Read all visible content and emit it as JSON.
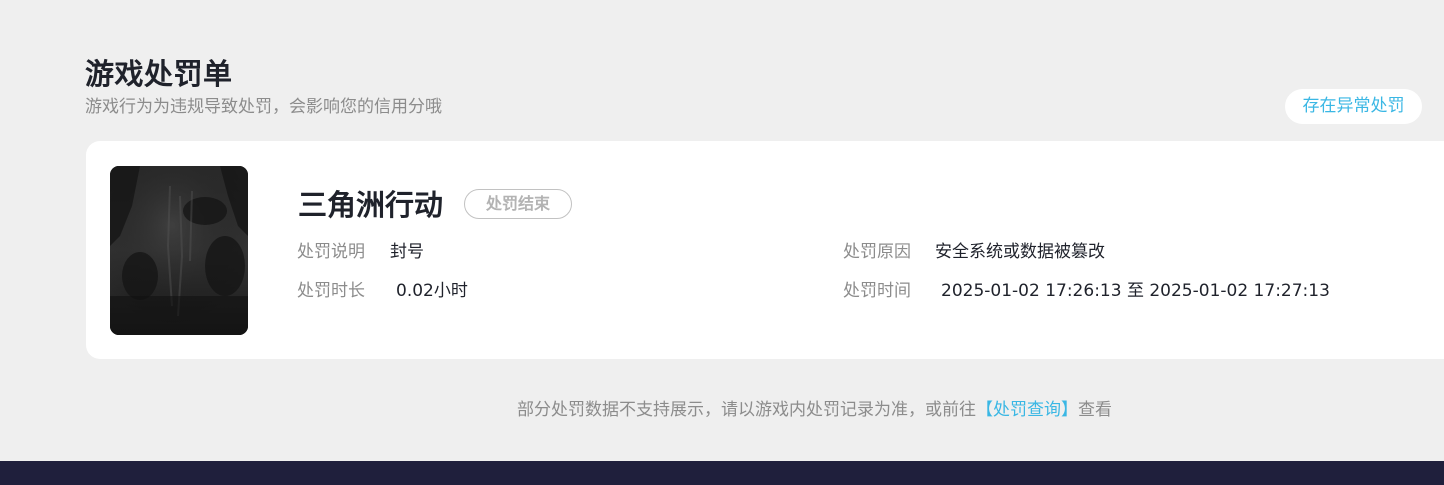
{
  "header": {
    "title": "游戏处罚单",
    "subtitle": "游戏行为为违规导致处罚，会影响您的信用分哦"
  },
  "anomaly_button": {
    "label": "存在异常处罚"
  },
  "penalty": {
    "cover_icon": "game-cover-image",
    "game_name": "三角洲行动",
    "status": "处罚结束",
    "description_label": "处罚说明",
    "description_value": "封号",
    "reason_label": "处罚原因",
    "reason_value": "安全系统或数据被篡改",
    "duration_label": "处罚时长",
    "duration_value": "0.02小时",
    "time_label": "处罚时间",
    "time_value": "2025-01-02 17:26:13 至 2025-01-02 17:27:13"
  },
  "footer": {
    "note_prefix": "部分处罚数据不支持展示，请以游戏内处罚记录为准，或前往",
    "link_text": "【处罚查询】",
    "note_suffix": "查看"
  },
  "colors": {
    "background": "#efefef",
    "card": "#ffffff",
    "accent": "#3ab7e4",
    "title": "#1f222b",
    "muted": "#8c8c8c",
    "bottom_bar": "#1f1f3c"
  }
}
